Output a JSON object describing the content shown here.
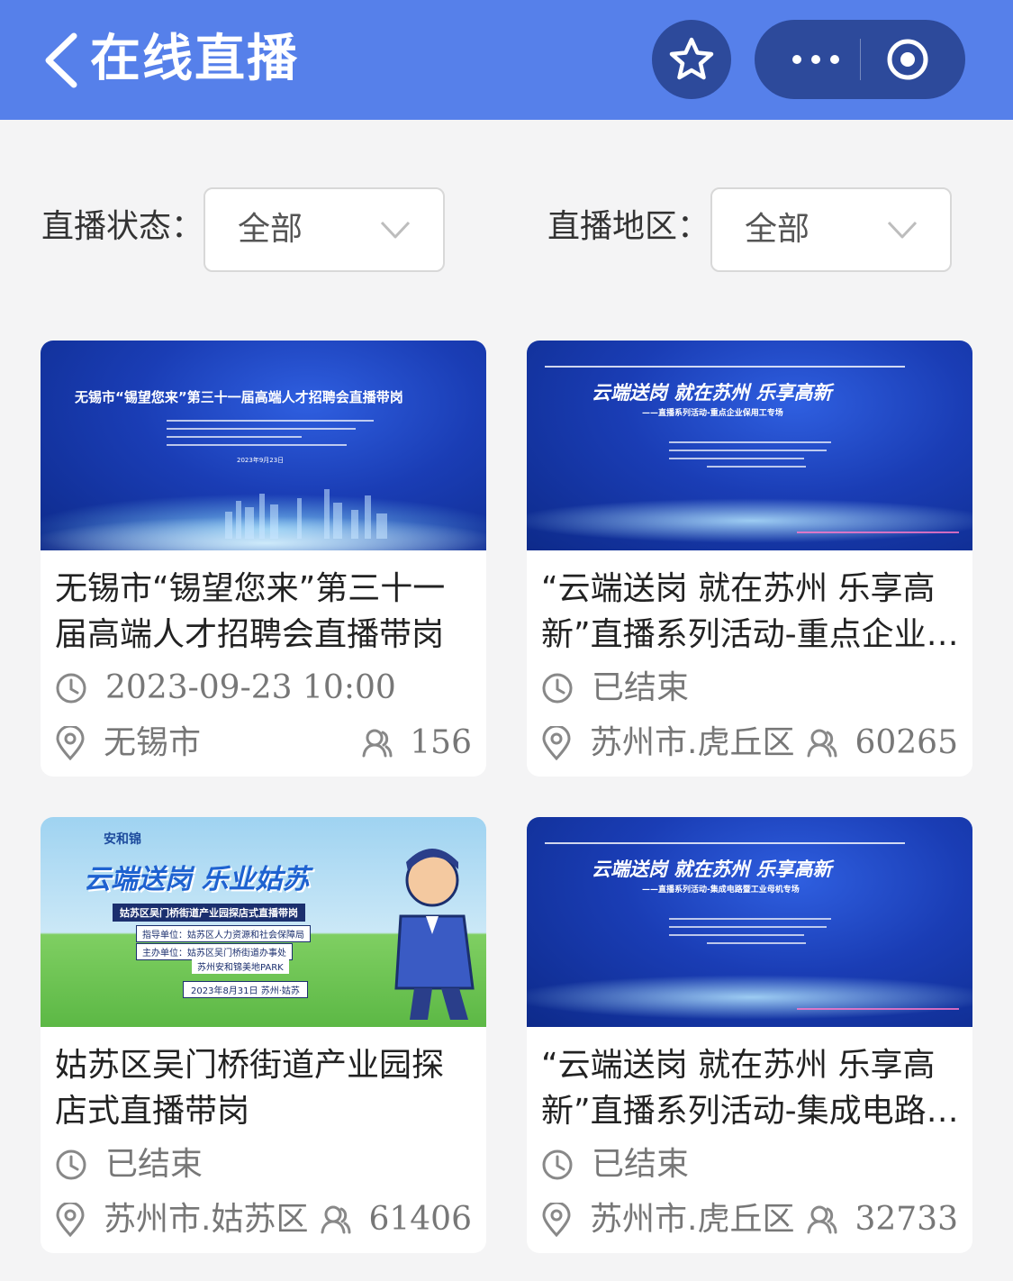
{
  "header": {
    "title": "在线直播",
    "back_icon": "chevron-left-icon",
    "favorite_icon": "star-icon",
    "more_icon": "more-dots-icon",
    "close_icon": "target-circle-icon",
    "color": "#5680ea"
  },
  "filters": {
    "status": {
      "label": "直播状态：",
      "value": "全部"
    },
    "region": {
      "label": "直播地区：",
      "value": "全部"
    }
  },
  "cards": [
    {
      "title": "无锡市“锡望您来”第三十一届高端人才招聘会直播带岗",
      "time": "2023-09-23 10:00",
      "location": "无锡市",
      "views": "156",
      "thumb": {
        "headline": "无锡市“锡望您来”第三十一届高端人才招聘会直播带岗",
        "date": "2023年9月23日"
      }
    },
    {
      "title": "“云端送岗 就在苏州 乐享高新”直播系列活动-重点企业保用工专场",
      "time": "已结束",
      "location": "苏州市.虎丘区",
      "views": "60265",
      "thumb": {
        "headline": "云端送岗 就在苏州 乐享高新",
        "subline": "——直播系列活动-重点企业保用工专场"
      }
    },
    {
      "title": "姑苏区吴门桥街道产业园探店式直播带岗",
      "time": "已结束",
      "location": "苏州市.姑苏区",
      "views": "61406",
      "thumb": {
        "brand": "安和锦",
        "headline": "云端送岗 乐业姑苏",
        "subline": "姑苏区吴门桥街道产业园探店式直播带岗",
        "guide": "指导单位：姑苏区人力资源和社会保障局",
        "host": "主办单位：姑苏区吴门桥街道办事处",
        "host2": "苏州安和锦美地PARK",
        "date": "2023年8月31日  苏州·姑苏"
      }
    },
    {
      "title": "“云端送岗 就在苏州 乐享高新”直播系列活动-集成电路暨工业母机专场",
      "time": "已结束",
      "location": "苏州市.虎丘区",
      "views": "32733",
      "thumb": {
        "headline": "云端送岗 就在苏州 乐享高新",
        "subline": "——直播系列活动-集成电路暨工业母机专场"
      }
    }
  ]
}
